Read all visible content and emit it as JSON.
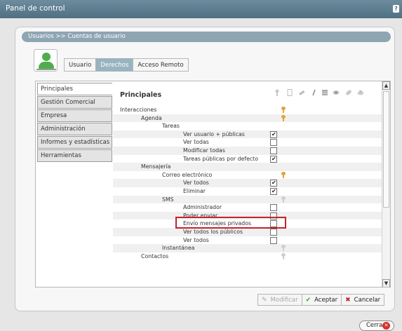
{
  "window": {
    "title": "Panel de control"
  },
  "breadcrumb": "Usuarios >> Cuentas de usuario",
  "tabs": [
    {
      "label": "Usuario",
      "active": false
    },
    {
      "label": "Derechos",
      "active": true
    },
    {
      "label": "Acceso Remoto",
      "active": false
    }
  ],
  "sidebar": {
    "items": [
      {
        "label": "Principales",
        "active": true
      },
      {
        "label": "Gestión Comercial",
        "active": false
      },
      {
        "label": "Empresa",
        "active": false
      },
      {
        "label": "Administración",
        "active": false
      },
      {
        "label": "Informes y estadísticas",
        "active": false
      },
      {
        "label": "Herramientas",
        "active": false
      }
    ]
  },
  "main": {
    "title": "Principales",
    "column_icons": [
      "key-icon",
      "document-icon",
      "pencil-icon",
      "pen-icon",
      "table-icon",
      "eye-icon",
      "leaf-icon",
      "print-icon"
    ],
    "rows": [
      {
        "label": "Interacciones",
        "level": 0,
        "key": "orange"
      },
      {
        "label": "Agenda",
        "level": 1,
        "key": "orange"
      },
      {
        "label": "Tareas",
        "level": 2
      },
      {
        "label": "Ver usuario + públicas",
        "level": 3,
        "checked": true
      },
      {
        "label": "Ver todas",
        "level": 3,
        "checked": false
      },
      {
        "label": "Modificar todas",
        "level": 3,
        "checked": false
      },
      {
        "label": "Tareas públicas por defecto",
        "level": 3,
        "checked": true,
        "highlighted": true
      },
      {
        "label": "Mensajería",
        "level": 1
      },
      {
        "label": "Correo electrónico",
        "level": 2,
        "key": "orange"
      },
      {
        "label": "Ver todos",
        "level": 3,
        "checked": true
      },
      {
        "label": "Eliminar",
        "level": 3,
        "checked": true
      },
      {
        "label": "SMS",
        "level": 2,
        "key": "gray"
      },
      {
        "label": "Administrador",
        "level": 3,
        "checked": false
      },
      {
        "label": "Poder enviar",
        "level": 3,
        "checked": false
      },
      {
        "label": "Envío mensajes privados",
        "level": 3,
        "checked": false
      },
      {
        "label": "Ver todos los públicos",
        "level": 3,
        "checked": false
      },
      {
        "label": "Ver todos",
        "level": 3,
        "checked": false
      },
      {
        "label": "Instantánea",
        "level": 2,
        "key": "gray"
      },
      {
        "label": "Contactos",
        "level": 1,
        "key": "gray"
      }
    ]
  },
  "buttons": {
    "modificar": "Modificar",
    "aceptar": "Aceptar",
    "cancelar": "Cancelar"
  },
  "close_label": "Cerrar",
  "colors": {
    "titlebar": "#5c7c8e",
    "tab_active": "#9ab3c1",
    "highlight": "#c8222a",
    "key_orange": "#e0a23a",
    "accept": "#3d9c2f",
    "cancel": "#c8222a"
  }
}
